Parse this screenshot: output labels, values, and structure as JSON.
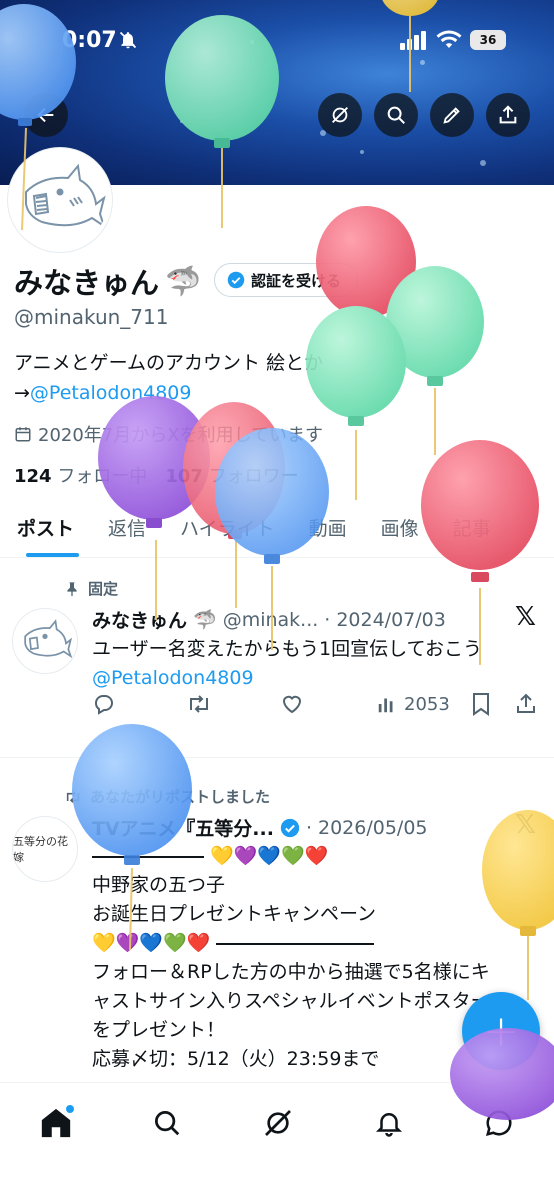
{
  "status_bar": {
    "time": "0:07",
    "battery": "36"
  },
  "header_icons": [
    "back-arrow-icon",
    "grok-icon",
    "search-icon",
    "edit-icon",
    "share-icon"
  ],
  "profile": {
    "name": "みなきゅん",
    "name_emoji": "🦈",
    "verify_label": "認証を受ける",
    "handle": "@minakun_711",
    "bio_line1": "アニメとゲームのアカウント 絵とか",
    "bio_arrow": "→",
    "bio_link": "@Petalodon4809",
    "joined": "2020年7月からXを利用しています",
    "following_count": "124",
    "following_label": "フォロー中",
    "followers_count": "107",
    "followers_label": "フォロワー"
  },
  "tabs": [
    "ポスト",
    "返信",
    "ハイライト",
    "動画",
    "画像",
    "記事"
  ],
  "active_tab": "ポスト",
  "posts": [
    {
      "context": "固定",
      "author": "みなきゅん",
      "author_emoji": "🦈",
      "handle": "@minak...",
      "date": "2024/07/03",
      "text": "ユーザー名変えたからもう1回宣伝しておこう",
      "link": "@Petalodon4809",
      "views": "2053"
    },
    {
      "context": "あなたがリポストしました",
      "author": "TVアニメ『五等分...",
      "date": "2026/05/05",
      "avatar_text": "五等分の花嫁",
      "line1_hearts": "💛💜💙💚❤️",
      "line2": "中野家の五つ子",
      "line3": "お誕生日プレゼントキャンペーン",
      "line4_hearts": "💛💜💙💚❤️",
      "line5": "フォロー＆RPした方の中から抽選で5名様にキ",
      "line6": "ャストサイン入りスペシャルイベントポスター",
      "line7": "をプレゼント！",
      "line8": "応募〆切：5/12（火）23:59まで"
    }
  ],
  "fab_label": "+",
  "bottom_nav": [
    "home-icon",
    "search-icon",
    "grok-icon",
    "notifications-icon",
    "messages-icon"
  ],
  "colors": {
    "accent": "#1d9bf0",
    "text": "#0f1419",
    "muted": "#536471"
  }
}
